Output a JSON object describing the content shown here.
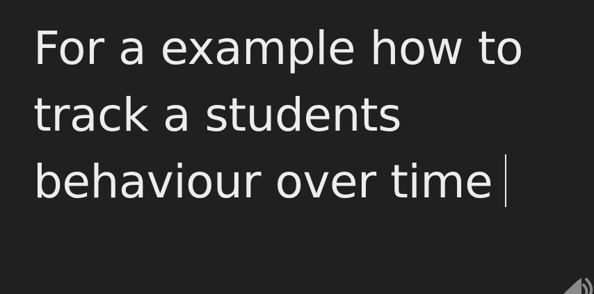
{
  "editor": {
    "lines": [
      "For a example how to",
      "track a students",
      "behaviour over time"
    ]
  },
  "icons": {
    "corner": "speaker-icon"
  },
  "colors": {
    "background": "#202020",
    "text": "#ededed",
    "icon": "#8a8a8a"
  }
}
